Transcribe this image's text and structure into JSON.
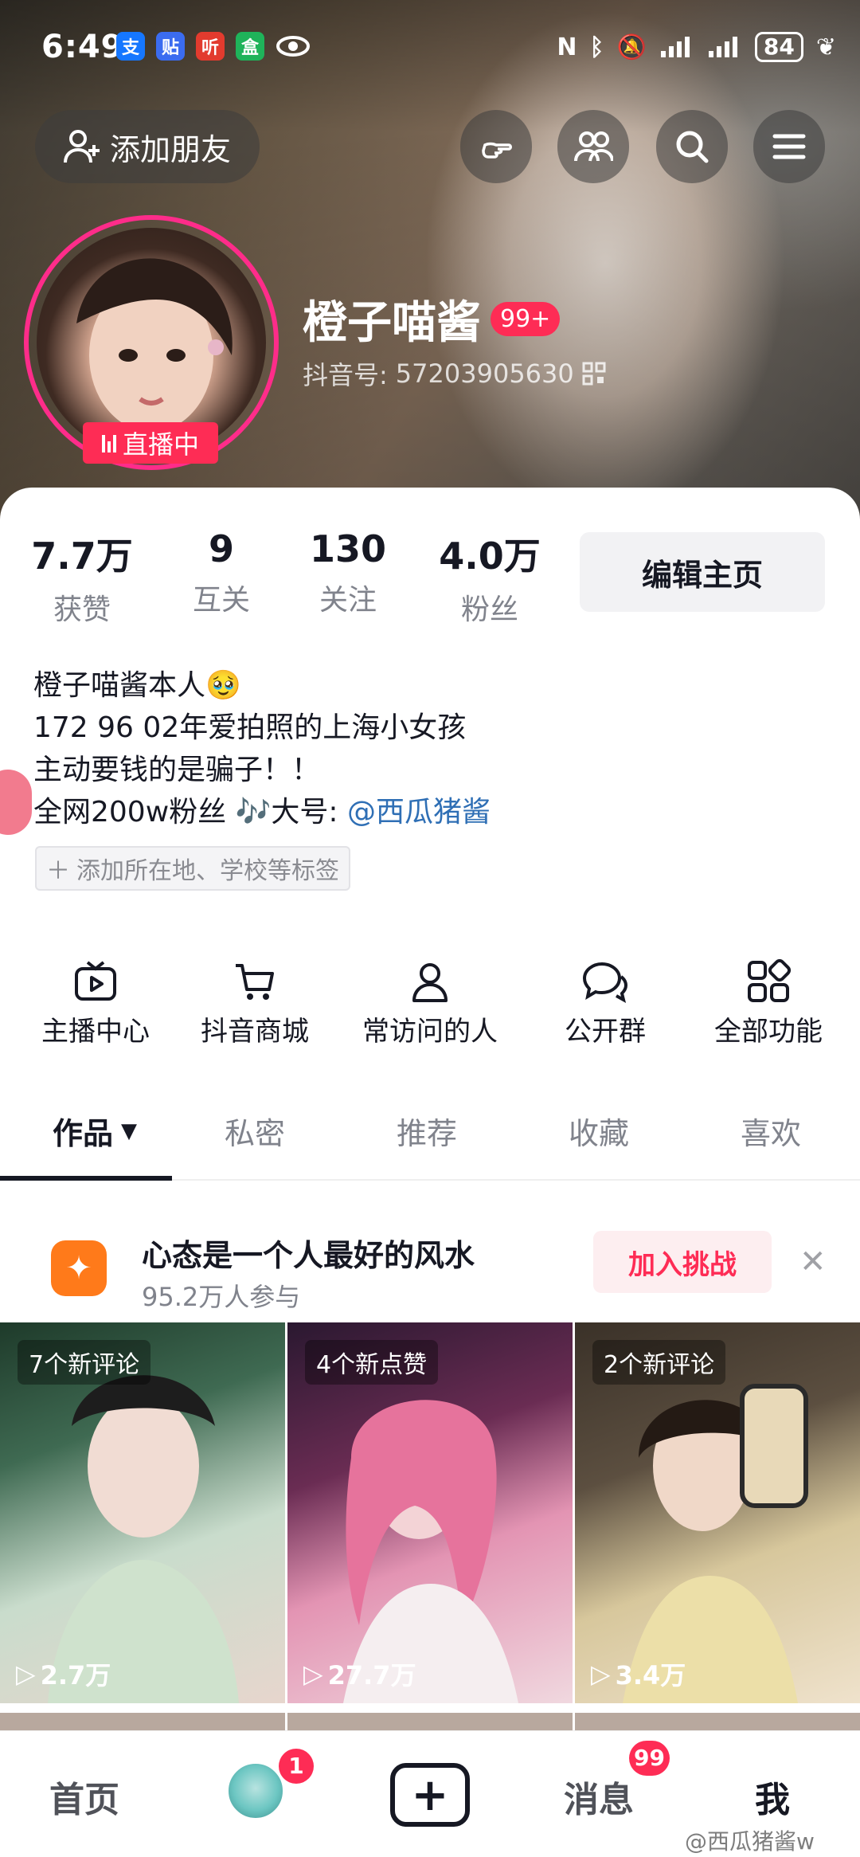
{
  "status_bar": {
    "time": "6:49",
    "battery": "84",
    "app_icons": [
      "支",
      "贴",
      "听",
      "盒"
    ]
  },
  "top_bar": {
    "add_friend_label": "添加朋友"
  },
  "profile": {
    "nickname": "橙子喵酱",
    "nickname_badge": "99+",
    "douyin_id_label": "抖音号:",
    "douyin_id": "57203905630",
    "live_label": "直播中"
  },
  "stats": [
    {
      "value": "7.7万",
      "label": "获赞"
    },
    {
      "value": "9",
      "label": "互关"
    },
    {
      "value": "130",
      "label": "关注"
    },
    {
      "value": "4.0万",
      "label": "粉丝"
    }
  ],
  "edit_label": "编辑主页",
  "bio": {
    "line1": "橙子喵酱本人",
    "line1_emoji": "🥹",
    "line2": "172 96 02年爱拍照的上海小女孩",
    "line3": "主动要钱的是骗子！！",
    "line4_prefix": "全网200w粉丝 🎶大号:",
    "mention": "@西瓜猪酱"
  },
  "tag_add_label": "添加所在地、学校等标签",
  "features": [
    {
      "label": "主播中心",
      "icon": "tv-icon"
    },
    {
      "label": "抖音商城",
      "icon": "cart-icon"
    },
    {
      "label": "常访问的人",
      "icon": "person-icon"
    },
    {
      "label": "公开群",
      "icon": "chat-icon"
    },
    {
      "label": "全部功能",
      "icon": "grid-icon"
    }
  ],
  "tabs": [
    "作品",
    "私密",
    "推荐",
    "收藏",
    "喜欢"
  ],
  "banner": {
    "title": "心态是一个人最好的风水",
    "subtitle": "95.2万人参与",
    "button": "加入挑战"
  },
  "videos": [
    {
      "note": "7个新评论",
      "plays": "2.7万",
      "colors": [
        "#2f5a43",
        "#bfd7c2",
        "#e9d7cf"
      ]
    },
    {
      "note": "4个新点赞",
      "plays": "27.7万",
      "colors": [
        "#5a2a4a",
        "#e79ab6",
        "#f2d6de"
      ]
    },
    {
      "note": "2个新评论",
      "plays": "3.4万",
      "colors": [
        "#4b4136",
        "#d8c8a0",
        "#efe3cf"
      ]
    }
  ],
  "bottom_nav": {
    "home": "首页",
    "messages": "消息",
    "me": "我",
    "friends_badge": "1",
    "messages_badge": "99"
  },
  "watermark": "@西瓜猪酱w"
}
